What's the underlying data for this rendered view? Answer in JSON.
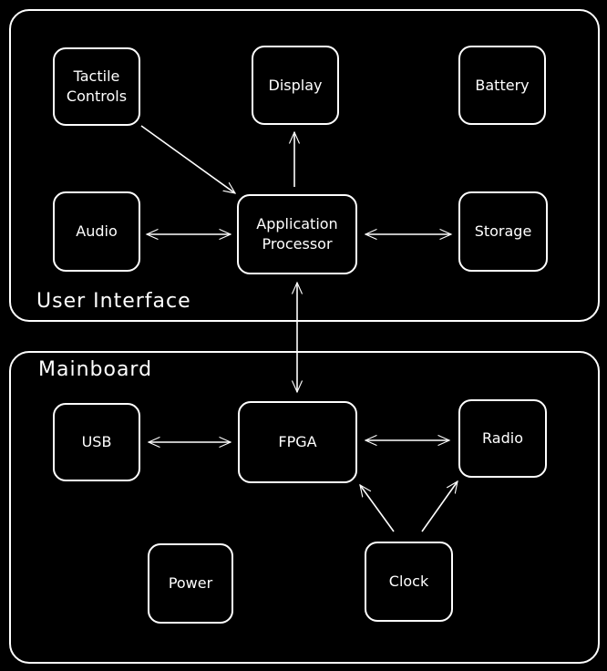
{
  "groups": {
    "user_interface": "User Interface",
    "mainboard": "Mainboard"
  },
  "nodes": {
    "tactile": "Tactile Controls",
    "display": "Display",
    "battery": "Battery",
    "audio": "Audio",
    "app_processor": "Application Processor",
    "storage": "Storage",
    "usb": "USB",
    "fpga": "FPGA",
    "radio": "Radio",
    "power": "Power",
    "clock": "Clock"
  },
  "colors": {
    "background": "#000000",
    "stroke": "#ffffff"
  }
}
